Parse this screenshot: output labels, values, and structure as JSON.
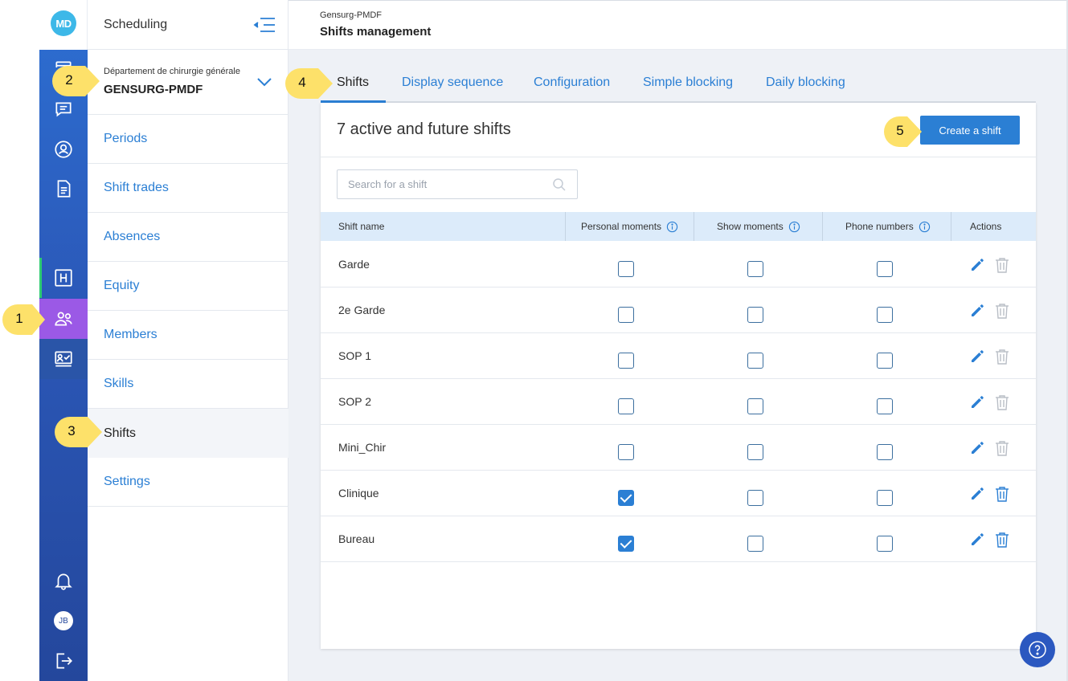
{
  "sidebar": {
    "title": "Scheduling",
    "department_name": "Département de chirurgie générale",
    "department_code": "GENSURG-PMDF",
    "items": [
      {
        "label": "Periods"
      },
      {
        "label": "Shift trades"
      },
      {
        "label": "Absences"
      },
      {
        "label": "Equity"
      },
      {
        "label": "Members"
      },
      {
        "label": "Skills"
      },
      {
        "label": "Shifts"
      },
      {
        "label": "Settings"
      }
    ]
  },
  "rail": {
    "logo": "MD",
    "avatar_initials": "JB",
    "icons": [
      "calendar-icon",
      "chat-icon",
      "user-circle-icon",
      "document-icon",
      "hospital-icon",
      "team-icon",
      "presentation-check-icon",
      "bell-icon",
      "logout-icon"
    ]
  },
  "header": {
    "org": "Gensurg-PMDF",
    "title": "Shifts management"
  },
  "tabs": [
    {
      "label": "Shifts"
    },
    {
      "label": "Display sequence"
    },
    {
      "label": "Configuration"
    },
    {
      "label": "Simple blocking"
    },
    {
      "label": "Daily blocking"
    }
  ],
  "card": {
    "title": "7 active and future shifts",
    "create_button": "Create a shift",
    "search_placeholder": "Search for a shift"
  },
  "table": {
    "columns": [
      "Shift name",
      "Personal moments",
      "Show moments",
      "Phone numbers",
      "Actions"
    ],
    "rows": [
      {
        "name": "Garde",
        "personal": false,
        "show": false,
        "phone": false
      },
      {
        "name": "2e Garde",
        "personal": false,
        "show": false,
        "phone": false
      },
      {
        "name": "SOP 1",
        "personal": false,
        "show": false,
        "phone": false
      },
      {
        "name": "SOP 2",
        "personal": false,
        "show": false,
        "phone": false
      },
      {
        "name": "Mini_Chir",
        "personal": false,
        "show": false,
        "phone": false
      },
      {
        "name": "Clinique",
        "personal": true,
        "show": false,
        "phone": false
      },
      {
        "name": "Bureau",
        "personal": true,
        "show": false,
        "phone": false
      }
    ]
  },
  "callouts": [
    "1",
    "2",
    "3",
    "4",
    "5"
  ],
  "colors": {
    "accent": "#2b7fd4",
    "rail": "#2b58b8",
    "rail_selected": "#9b59e6",
    "callout": "#fde16a"
  }
}
